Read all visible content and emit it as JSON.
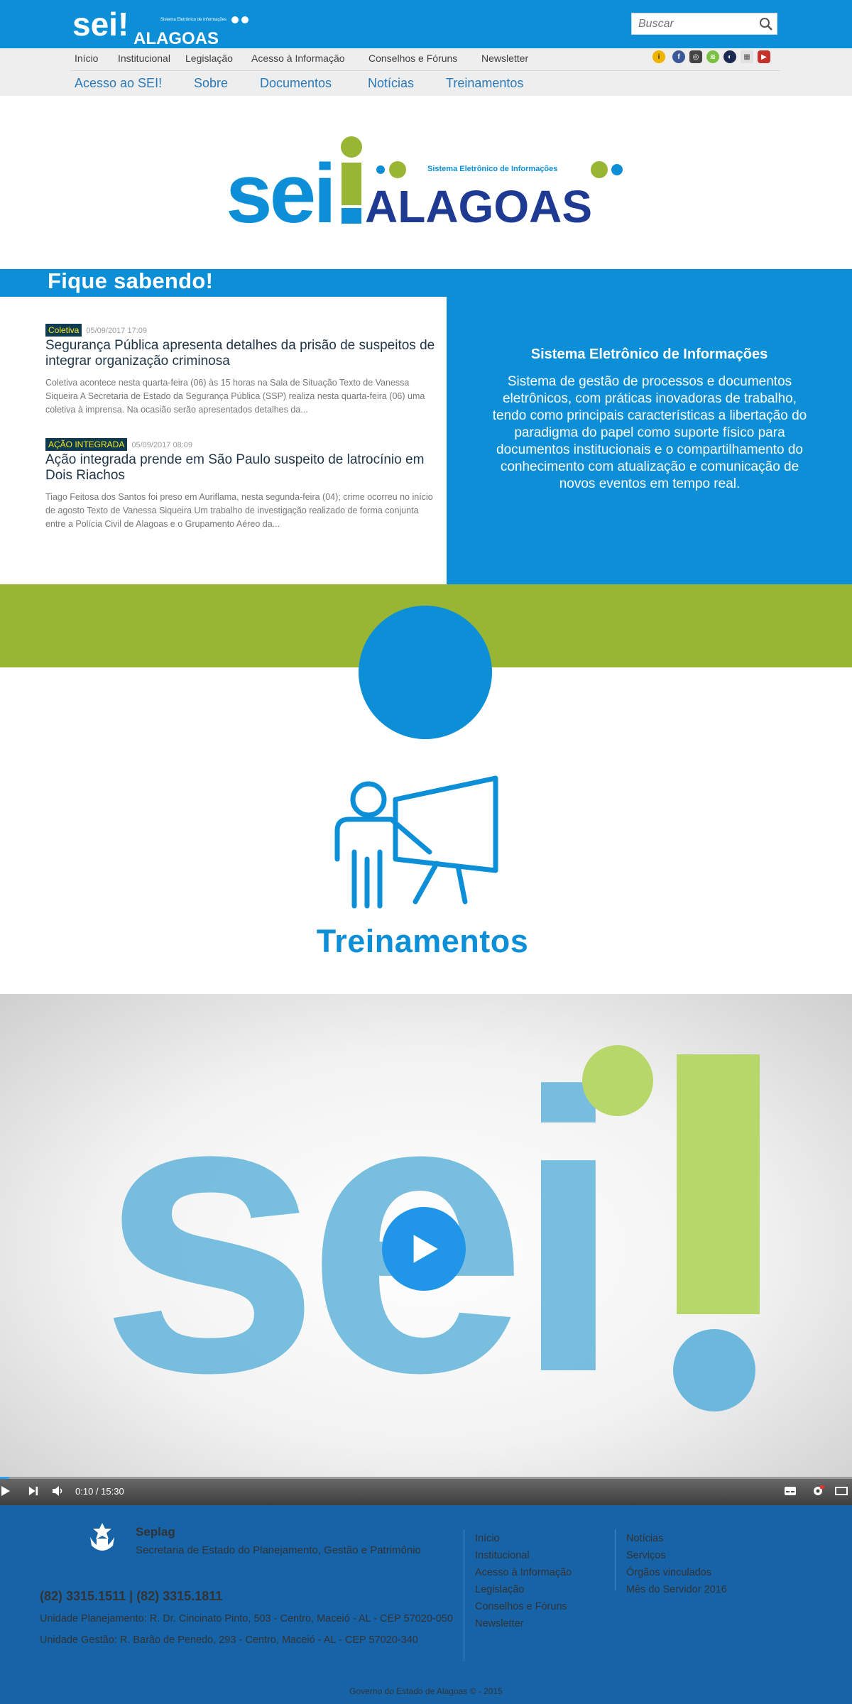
{
  "header": {
    "logo_brand": "sei!",
    "logo_state": "ALAGOAS",
    "logo_tagline": "Sistema Eletrônico de Informações",
    "search_placeholder": "Buscar"
  },
  "top_nav": [
    "Início",
    "Institucional",
    "Legislação",
    "Acesso à Informação",
    "Conselhos e Fóruns",
    "Newsletter"
  ],
  "social_icons": [
    "info-icon",
    "facebook-icon",
    "instagram-icon",
    "spotify-icon",
    "flickr-icon",
    "rss-icon",
    "youtube-icon"
  ],
  "sec_nav": [
    "Acesso ao SEI!",
    "Sobre",
    "Documentos",
    "Notícias",
    "Treinamentos"
  ],
  "hero": {
    "brand": "sei",
    "state": "ALAGOAS",
    "tagline": "Sistema Eletrônico de Informações"
  },
  "fique": {
    "title": "Fique sabendo!",
    "news": [
      {
        "tag": "Coletiva",
        "date": "05/09/2017 17:09",
        "title": "Segurança Pública apresenta detalhes da prisão de suspeitos de integrar organização criminosa",
        "text": "Coletiva acontece nesta quarta-feira (06) às 15 horas na Sala de Situação   Texto de Vanessa Siqueira   A Secretaria de Estado da Segurança Pública (SSP) realiza nesta quarta-feira (06) uma coletiva à imprensa. Na ocasião serão apresentados detalhes da..."
      },
      {
        "tag": "AÇÃO INTEGRADA",
        "date": "05/09/2017 08:09",
        "title": "Ação integrada prende em São Paulo suspeito de latrocínio em Dois Riachos",
        "text": "Tiago Feitosa dos Santos foi preso em Auriflama, nesta segunda-feira (04); crime ocorreu no início de agosto  Texto de Vanessa Siqueira Um trabalho de investigação realizado de forma conjunta entre a Polícia Civil de Alagoas e o Grupamento Aéreo da..."
      }
    ]
  },
  "sei_info": {
    "title": "Sistema Eletrônico de Informações",
    "text": "Sistema de gestão de processos e documentos eletrônicos, com práticas inovadoras de trabalho, tendo como principais características a libertação do paradigma do papel como suporte físico para documentos institucionais e o compartilhamento do conhecimento com atualização e comunicação de novos eventos em tempo real."
  },
  "treinamentos": {
    "label": "Treinamentos"
  },
  "video": {
    "time": "0:10 / 15:30",
    "progress": 0.011
  },
  "footer": {
    "org": "Seplag",
    "org_full": "Secretaria de Estado do Planejamento, Gestão e Patrimônio",
    "phone": "(82) 3315.1511 | (82) 3315.1811",
    "address_1": "Unidade Planejamento: R. Dr. Cincinato Pinto, 503 - Centro, Maceió - AL - CEP 57020-050",
    "address_2": "Unidade Gestão: R. Barão de Penedo, 293 - Centro, Maceió - AL - CEP 57020-340",
    "links_col1": [
      "Início",
      "Institucional",
      "Acesso à Informação",
      "Legislação",
      "Conselhos e Fóruns",
      "Newsletter"
    ],
    "links_col2": [
      "Notícias",
      "Serviços",
      "Órgãos vinculados",
      "Mês do Servidor 2016"
    ],
    "copyright": "Governo do Estado de Alagoas © - 2015"
  },
  "colors": {
    "primary_blue": "#0d8fd8",
    "green": "#98b634",
    "navy": "#1f3a93",
    "footer_blue": "#1763a8"
  }
}
